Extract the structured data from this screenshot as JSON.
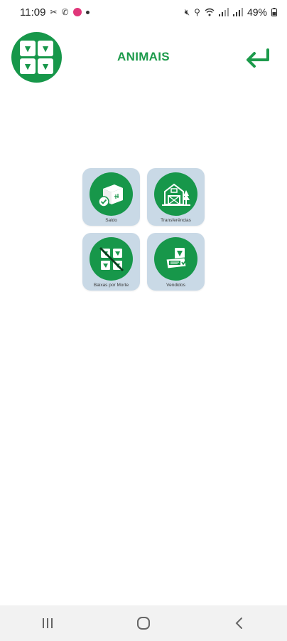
{
  "status_bar": {
    "time": "11:09",
    "battery": "49%"
  },
  "header": {
    "title": "ANIMAIS",
    "logo_icon": "cattle-grid-logo",
    "back_icon": "return-arrow-icon"
  },
  "menu": {
    "items": [
      {
        "label": "Saldo",
        "icon": "boxes-check-icon"
      },
      {
        "label": "Transferências",
        "icon": "farm-barn-icon"
      },
      {
        "label": "Baixas por Morte",
        "icon": "cattle-grid-crossed-icon"
      },
      {
        "label": "Vendidos",
        "icon": "sale-tag-icon"
      }
    ]
  },
  "colors": {
    "brand_green": "#17974a",
    "tile_bg": "#c9d9e6",
    "title_green": "#1c9a4b"
  },
  "nav": {
    "recents_icon": "recents-icon",
    "home_icon": "home-icon",
    "back_icon": "back-chevron-icon"
  }
}
